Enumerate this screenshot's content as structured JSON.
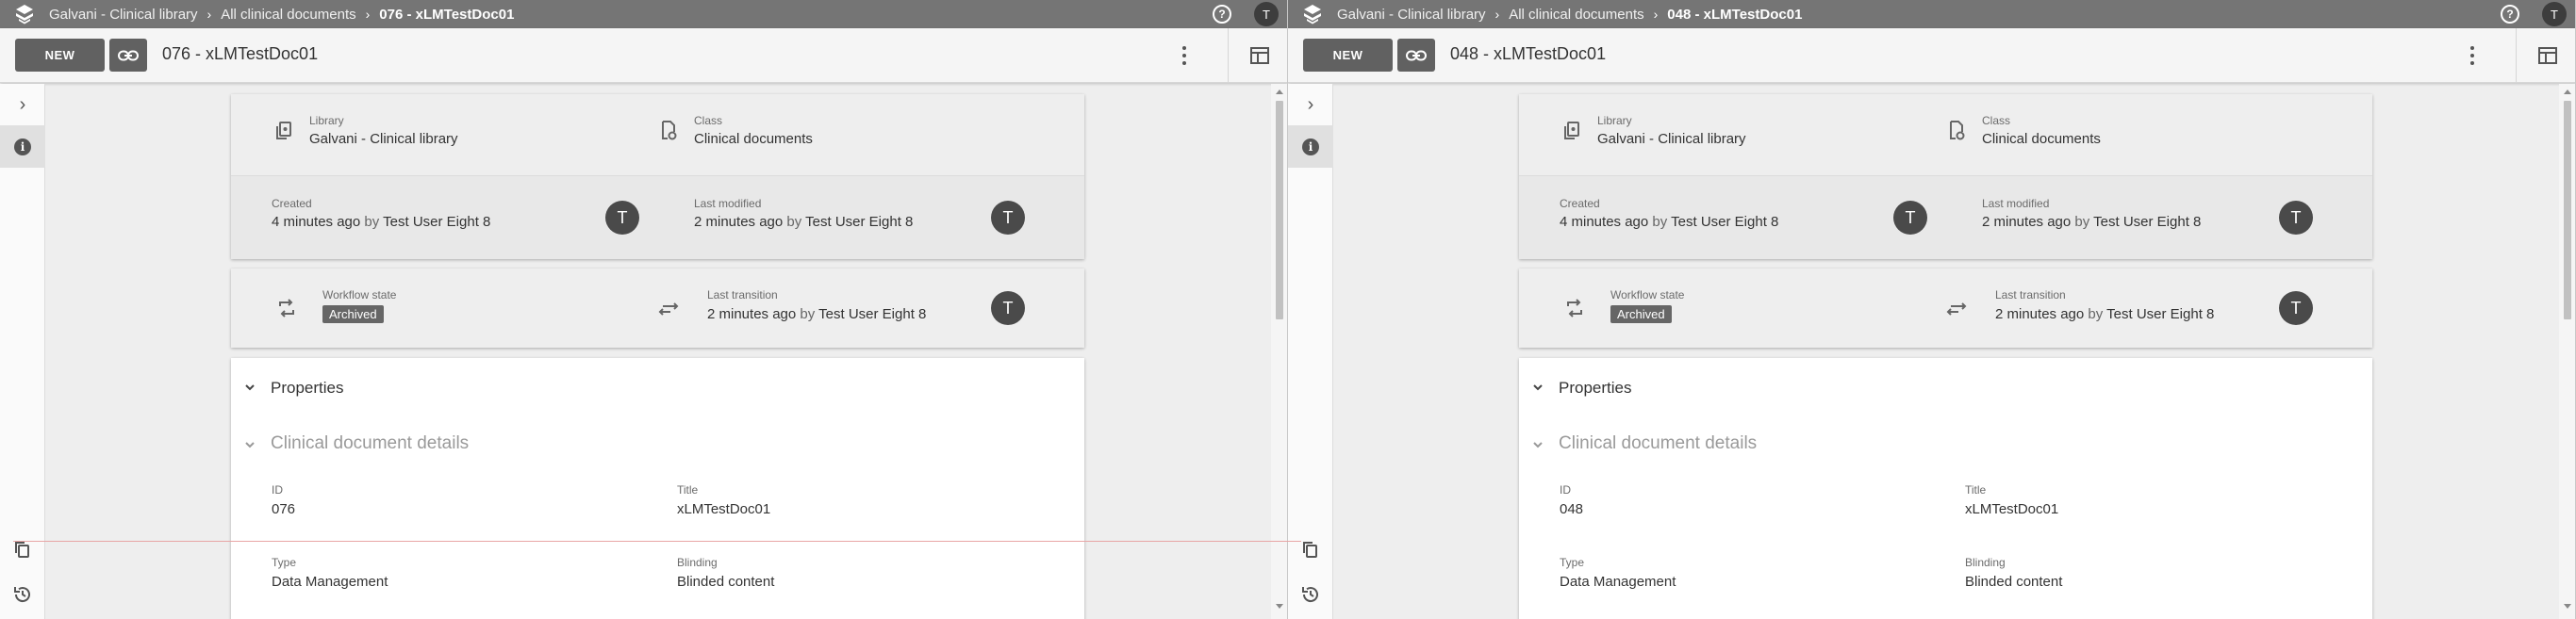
{
  "panes": [
    {
      "breadcrumbs": [
        "Galvani - Clinical library",
        "All clinical documents",
        "076 - xLMTestDoc01"
      ],
      "user_initial": "T",
      "toolbar": {
        "new_label": "NEW",
        "doc_title": "076 - xLMTestDoc01"
      },
      "library": {
        "label": "Library",
        "value": "Galvani - Clinical library"
      },
      "class": {
        "label": "Class",
        "value": "Clinical documents"
      },
      "created": {
        "label": "Created",
        "when": "4 minutes ago",
        "by_word": "by",
        "user": "Test User Eight 8",
        "avatar": "T"
      },
      "modified": {
        "label": "Last modified",
        "when": "2 minutes ago",
        "by_word": "by",
        "user": "Test User Eight 8",
        "avatar": "T"
      },
      "workflow": {
        "label": "Workflow state",
        "state": "Archived"
      },
      "transition": {
        "label": "Last transition",
        "when": "2 minutes ago",
        "by_word": "by",
        "user": "Test User Eight 8",
        "avatar": "T"
      },
      "properties": {
        "heading": "Properties",
        "section": "Clinical document details",
        "id": {
          "label": "ID",
          "value": "076"
        },
        "title": {
          "label": "Title",
          "value": "xLMTestDoc01"
        },
        "type": {
          "label": "Type",
          "value": "Data Management"
        },
        "blinding": {
          "label": "Blinding",
          "value": "Blinded content"
        }
      }
    },
    {
      "breadcrumbs": [
        "Galvani - Clinical library",
        "All clinical documents",
        "048 - xLMTestDoc01"
      ],
      "user_initial": "T",
      "toolbar": {
        "new_label": "NEW",
        "doc_title": "048 - xLMTestDoc01"
      },
      "library": {
        "label": "Library",
        "value": "Galvani - Clinical library"
      },
      "class": {
        "label": "Class",
        "value": "Clinical documents"
      },
      "created": {
        "label": "Created",
        "when": "4 minutes ago",
        "by_word": "by",
        "user": "Test User Eight 8",
        "avatar": "T"
      },
      "modified": {
        "label": "Last modified",
        "when": "2 minutes ago",
        "by_word": "by",
        "user": "Test User Eight 8",
        "avatar": "T"
      },
      "workflow": {
        "label": "Workflow state",
        "state": "Archived"
      },
      "transition": {
        "label": "Last transition",
        "when": "2 minutes ago",
        "by_word": "by",
        "user": "Test User Eight 8",
        "avatar": "T"
      },
      "properties": {
        "heading": "Properties",
        "section": "Clinical document details",
        "id": {
          "label": "ID",
          "value": "048"
        },
        "title": {
          "label": "Title",
          "value": "xLMTestDoc01"
        },
        "type": {
          "label": "Type",
          "value": "Data Management"
        },
        "blinding": {
          "label": "Blinding",
          "value": "Blinded content"
        }
      }
    }
  ],
  "icons": {
    "app_logo": "layers-icon",
    "help": "help-circle-icon",
    "link": "link-icon",
    "more": "more-vert-icon",
    "layout": "layout-panel-icon",
    "expand": "chevron-right-icon",
    "info": "info-icon",
    "copy": "copy-icon",
    "history": "history-icon",
    "library": "library-icon",
    "class": "class-icon",
    "workflow": "sync-icon",
    "transition": "transition-icon",
    "collapse": "chevron-down-icon"
  },
  "colors": {
    "topbar": "#757575",
    "button": "#616161",
    "badge": "#666666",
    "avatar": "#4a4a4a"
  }
}
